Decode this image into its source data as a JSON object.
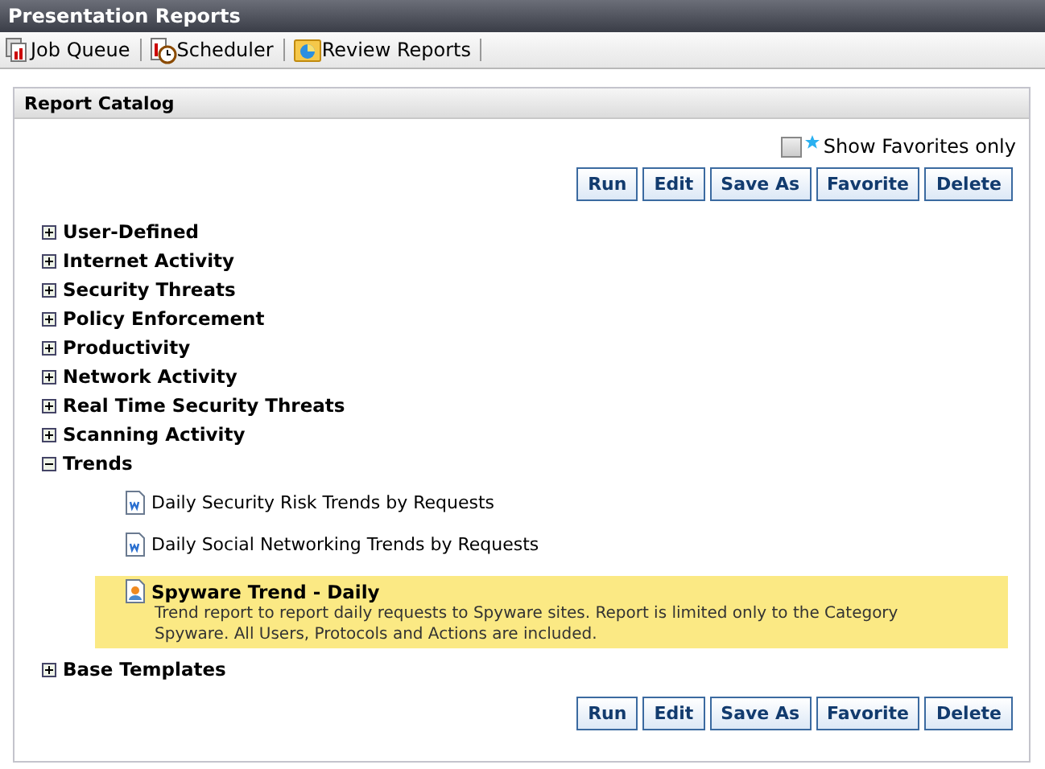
{
  "window": {
    "title": "Presentation Reports"
  },
  "toolbar": [
    {
      "label": "Job Queue",
      "kind": "queue"
    },
    {
      "label": "Scheduler",
      "kind": "scheduler"
    },
    {
      "label": "Review Reports",
      "kind": "review"
    }
  ],
  "panel": {
    "title": "Report Catalog",
    "favorites_filter": {
      "label": "Show Favorites only",
      "checked": false
    },
    "top_buttons": [
      "Run",
      "Edit",
      "Save As",
      "Favorite",
      "Delete"
    ],
    "categories": [
      {
        "label": "User-Defined",
        "expanded": false
      },
      {
        "label": "Internet Activity",
        "expanded": false
      },
      {
        "label": "Security Threats",
        "expanded": false
      },
      {
        "label": "Policy Enforcement",
        "expanded": false
      },
      {
        "label": "Productivity",
        "expanded": false
      },
      {
        "label": "Network Activity",
        "expanded": false
      },
      {
        "label": "Real Time Security Threats",
        "expanded": false
      },
      {
        "label": "Scanning Activity",
        "expanded": false
      },
      {
        "label": "Trends",
        "expanded": true,
        "children": [
          {
            "label": "Daily Security Risk Trends by Requests",
            "kind": "standard",
            "selected": false
          },
          {
            "label": "Daily Social Networking Trends by Requests",
            "kind": "standard",
            "selected": false
          },
          {
            "label": "Spyware Trend - Daily",
            "kind": "custom",
            "selected": true,
            "description": "Trend report to report daily requests to Spyware sites. Report is limited only to the Category Spyware. All Users, Protocols and Actions are included."
          }
        ]
      },
      {
        "label": "Base Templates",
        "expanded": false
      }
    ],
    "bottom_buttons": [
      "Run",
      "Edit",
      "Save As",
      "Favorite",
      "Delete"
    ]
  }
}
